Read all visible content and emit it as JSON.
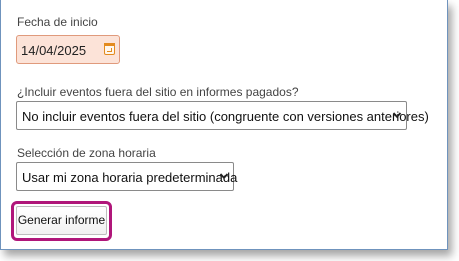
{
  "form": {
    "start_date_label": "Fecha de inicio",
    "start_date_value": "14/04/2025",
    "offsite_label": "¿Incluir eventos fuera del sitio en informes pagados?",
    "offsite_selected": "No incluir eventos fuera del sitio (congruente con versiones anteriores)",
    "timezone_label": "Selección de zona horaria",
    "timezone_selected": "Usar mi zona horaria predeterminada",
    "generate_button": "Generar informe"
  },
  "colors": {
    "date_field_bg": "#fce3d8",
    "date_field_border": "#e09a7c",
    "calendar_icon": "#e38b1f",
    "highlight_border": "#b0167a",
    "frame_border": "#6f93bd"
  },
  "icons": {
    "date": "calendar-icon",
    "select": "chevron-down-icon"
  }
}
